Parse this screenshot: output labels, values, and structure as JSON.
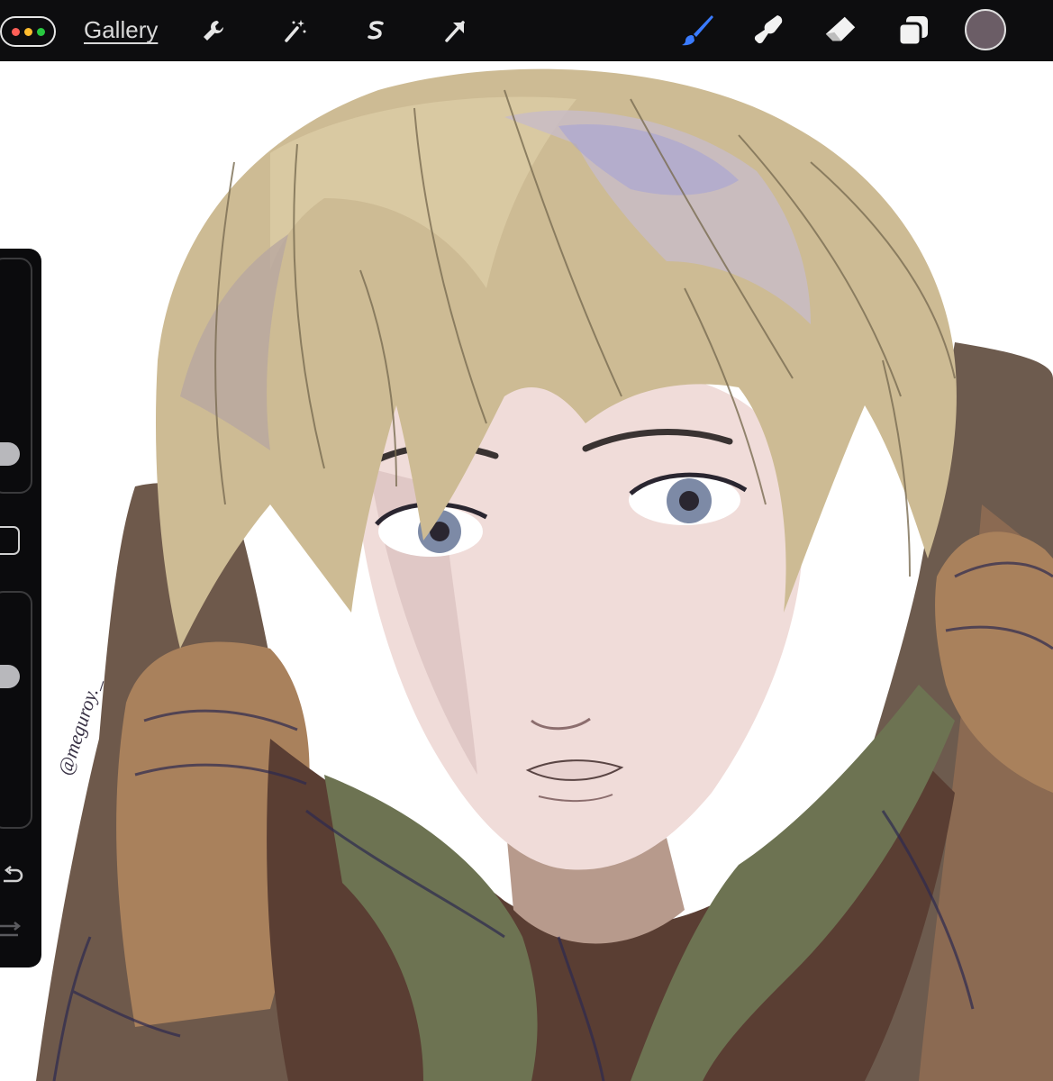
{
  "topbar": {
    "gallery_label": "Gallery",
    "menu_dot_colors": [
      "#ff5f57",
      "#febc2e",
      "#28c840"
    ],
    "tools": [
      {
        "name": "actions",
        "icon": "wrench-icon"
      },
      {
        "name": "adjustments",
        "icon": "magic-wand-icon"
      },
      {
        "name": "selection",
        "icon": "selection-s-icon"
      },
      {
        "name": "transform",
        "icon": "arrow-cursor-icon"
      },
      {
        "name": "brush",
        "icon": "brush-icon",
        "active": true
      },
      {
        "name": "smudge",
        "icon": "smudge-icon"
      },
      {
        "name": "eraser",
        "icon": "eraser-icon"
      },
      {
        "name": "layers",
        "icon": "layers-icon"
      }
    ],
    "current_color": "#6b5d66",
    "active_tool_color": "#3a7bff"
  },
  "sidebar": {
    "controls": [
      "brush-size-slider",
      "modify-button",
      "opacity-slider",
      "undo-button",
      "redo-button"
    ]
  },
  "canvas": {
    "watermark": "@meguroy._"
  }
}
